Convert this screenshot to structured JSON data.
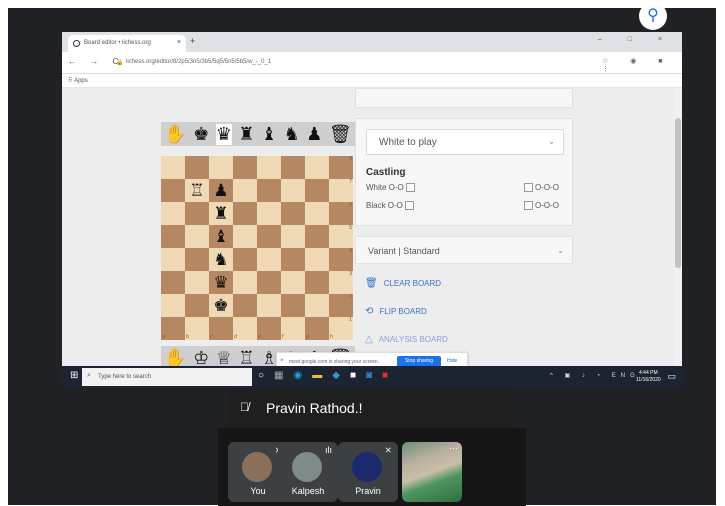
{
  "browser": {
    "tab_title": "Board editor • lichess.org",
    "tab_close": "×",
    "new_tab": "+",
    "window_controls": "– □ ×",
    "nav": "← → C",
    "url": "lichess.org/editor/8/2p5/3n5/3b5/5q5/5n5/5b5/w_-_0_1",
    "bookmarks_label": "Apps"
  },
  "editor": {
    "spare_top": [
      {
        "glyph": "✋",
        "name": "pointer-icon",
        "sel": false
      },
      {
        "glyph": "♚",
        "name": "black-king-icon",
        "sel": false
      },
      {
        "glyph": "♛",
        "name": "black-queen-icon",
        "sel": true
      },
      {
        "glyph": "♜",
        "name": "black-rook-icon",
        "sel": false
      },
      {
        "glyph": "♝",
        "name": "black-bishop-icon",
        "sel": false
      },
      {
        "glyph": "♞",
        "name": "black-knight-icon",
        "sel": false
      },
      {
        "glyph": "♟",
        "name": "black-pawn-icon",
        "sel": false
      },
      {
        "glyph": "🗑",
        "name": "trash-icon",
        "sel": false
      }
    ],
    "spare_bottom": [
      {
        "glyph": "✋",
        "name": "pointer-icon",
        "sel": false
      },
      {
        "glyph": "♔",
        "name": "white-king-icon",
        "sel": false
      },
      {
        "glyph": "♕",
        "name": "white-queen-icon",
        "sel": false
      },
      {
        "glyph": "♖",
        "name": "white-rook-icon",
        "sel": false
      },
      {
        "glyph": "♗",
        "name": "white-bishop-icon",
        "sel": false
      },
      {
        "glyph": "♘",
        "name": "white-knight-icon",
        "sel": false
      },
      {
        "glyph": "♙",
        "name": "white-pawn-icon",
        "sel": false
      },
      {
        "glyph": "🗑",
        "name": "trash-icon",
        "sel": false
      }
    ],
    "pieces": [
      {
        "square": "b7",
        "glyph": "♖",
        "name": "white-rook-piece"
      },
      {
        "square": "c7",
        "glyph": "♟",
        "name": "black-pawn-piece"
      },
      {
        "square": "c6",
        "glyph": "♜",
        "name": "black-rook-piece"
      },
      {
        "square": "c5",
        "glyph": "♝",
        "name": "black-bishop-piece"
      },
      {
        "square": "c4",
        "glyph": "♞",
        "name": "black-knight-piece"
      },
      {
        "square": "c3",
        "glyph": "♛",
        "name": "black-queen-piece"
      },
      {
        "square": "c2",
        "glyph": "♚",
        "name": "black-king-piece"
      }
    ],
    "files": [
      "a",
      "b",
      "c",
      "d",
      "e",
      "f",
      "g",
      "h"
    ],
    "ranks": [
      "8",
      "7",
      "6",
      "5",
      "4",
      "3",
      "2",
      "1"
    ]
  },
  "panel": {
    "turn_select": "White to play",
    "castling_title": "Castling",
    "white_oo": "White O-O",
    "white_ooo": "O-O-O",
    "black_oo": "Black O-O",
    "black_ooo": "O-O-O",
    "variant": "Variant | Standard",
    "clear_board": "CLEAR BOARD",
    "flip_board": "FLIP BOARD",
    "analysis_board": "ANALYSIS BOARD"
  },
  "toast": {
    "message": "meet.google.com is sharing your screen.",
    "stop_button": "Stop sharing",
    "hide": "Hide"
  },
  "taskbar": {
    "search_placeholder": "Type here to search",
    "time": "4:44 PM",
    "date": "11/16/2020"
  },
  "meet": {
    "presenter": "Pravin Rathod.!",
    "participants": [
      {
        "label": "You",
        "muted": true,
        "avatar_color": "#8a6f5a"
      },
      {
        "label": "Kalpesh",
        "muted": false,
        "avatar_color": "#7f8a8c"
      },
      {
        "label": "Pravin",
        "muted": true,
        "avatar_color": "#1a2a6c"
      }
    ]
  },
  "colors": {
    "light_square": "#f0d9b5",
    "dark_square": "#b58863",
    "link_blue": "#3b73c4",
    "meet_bg": "#202124"
  }
}
